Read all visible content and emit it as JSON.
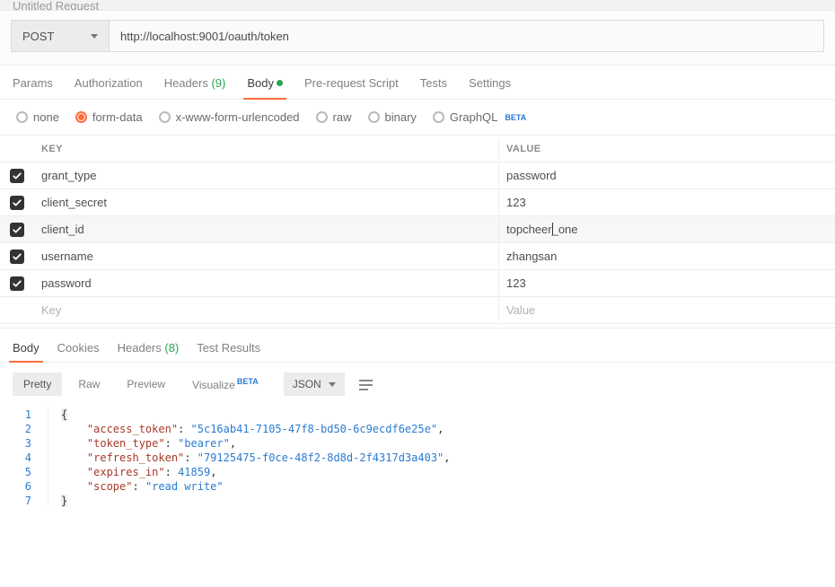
{
  "header": {
    "title": "Untitled Request"
  },
  "request": {
    "method": "POST",
    "url": "http://localhost:9001/oauth/token"
  },
  "tabs": {
    "params": "Params",
    "authorization": "Authorization",
    "headers": "Headers",
    "headers_count": "(9)",
    "body": "Body",
    "prerequest": "Pre-request Script",
    "tests": "Tests",
    "settings": "Settings"
  },
  "body_types": {
    "none": "none",
    "formdata": "form-data",
    "xwww": "x-www-form-urlencoded",
    "raw": "raw",
    "binary": "binary",
    "graphql": "GraphQL",
    "beta": "BETA"
  },
  "kv": {
    "key_header": "KEY",
    "value_header": "VALUE",
    "placeholder_key": "Key",
    "placeholder_value": "Value",
    "rows": [
      {
        "checked": true,
        "key": "grant_type",
        "value": "password"
      },
      {
        "checked": true,
        "key": "client_secret",
        "value": "123"
      },
      {
        "checked": true,
        "key": "client_id",
        "value": "topcheer_one",
        "highlight": true,
        "cursor_at": 8
      },
      {
        "checked": true,
        "key": "username",
        "value": "zhangsan"
      },
      {
        "checked": true,
        "key": "password",
        "value": "123"
      }
    ]
  },
  "response": {
    "tabs": {
      "body": "Body",
      "cookies": "Cookies",
      "headers": "Headers",
      "headers_count": "(8)",
      "test_results": "Test Results"
    },
    "toolbar": {
      "pretty": "Pretty",
      "raw": "Raw",
      "preview": "Preview",
      "visualize": "Visualize",
      "beta": "BETA",
      "format": "JSON"
    },
    "json": {
      "access_token": "5c16ab41-7105-47f8-bd50-6c9ecdf6e25e",
      "token_type": "bearer",
      "refresh_token": "79125475-f0ce-48f2-8d8d-2f4317d3a403",
      "expires_in": 41859,
      "scope": "read write"
    }
  }
}
